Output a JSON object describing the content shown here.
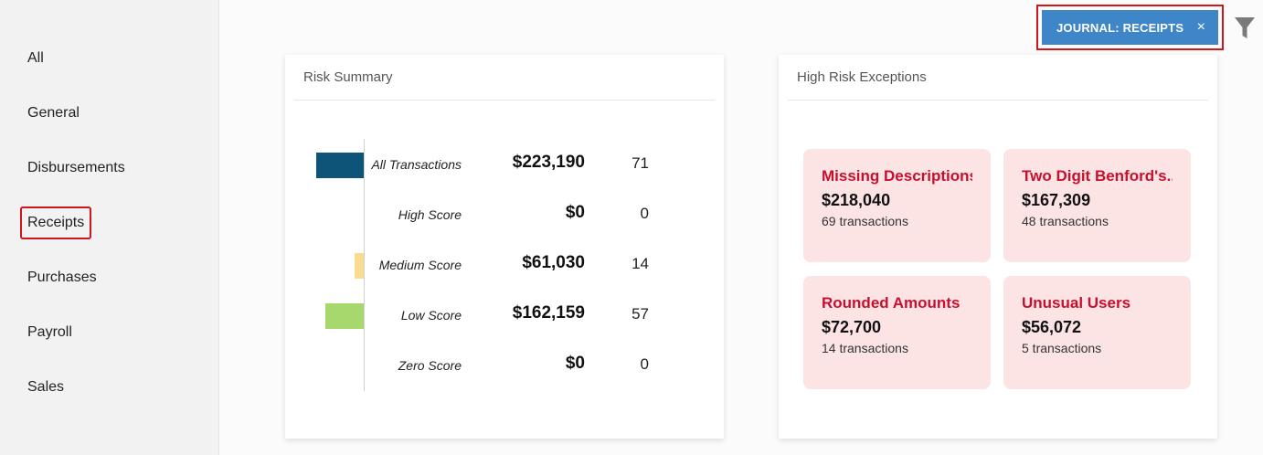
{
  "sidebar": {
    "items": [
      {
        "label": "All"
      },
      {
        "label": "General"
      },
      {
        "label": "Disbursements"
      },
      {
        "label": "Receipts"
      },
      {
        "label": "Purchases"
      },
      {
        "label": "Payroll"
      },
      {
        "label": "Sales"
      }
    ],
    "selected": "Receipts"
  },
  "filter": {
    "chip_label": "JOURNAL: RECEIPTS",
    "close_glyph": "×",
    "icon": "filter-icon"
  },
  "risk_summary": {
    "title": "Risk Summary",
    "rows": [
      {
        "label": "All Transactions",
        "amount": "$223,190",
        "count": "71",
        "color": "#0e5479"
      },
      {
        "label": "High Score",
        "amount": "$0",
        "count": "0",
        "color": "#d9534f"
      },
      {
        "label": "Medium Score",
        "amount": "$61,030",
        "count": "14",
        "color": "#f9dc8f"
      },
      {
        "label": "Low Score",
        "amount": "$162,159",
        "count": "57",
        "color": "#a6d86e"
      },
      {
        "label": "Zero Score",
        "amount": "$0",
        "count": "0",
        "color": "#cccccc"
      }
    ]
  },
  "high_risk": {
    "title": "High Risk Exceptions",
    "tiles": [
      {
        "title": "Missing Descriptions",
        "amount": "$218,040",
        "count": "69 transactions"
      },
      {
        "title": "Two Digit Benford's...",
        "amount": "$167,309",
        "count": "48 transactions"
      },
      {
        "title": "Rounded Amounts",
        "amount": "$72,700",
        "count": "14 transactions"
      },
      {
        "title": "Unusual Users",
        "amount": "$56,072",
        "count": "5 transactions"
      }
    ]
  },
  "colors": {
    "accent": "#3f86c8",
    "highlight_border": "#d0161c",
    "tile_bg": "#fce4e5",
    "tile_title": "#c8102e"
  }
}
